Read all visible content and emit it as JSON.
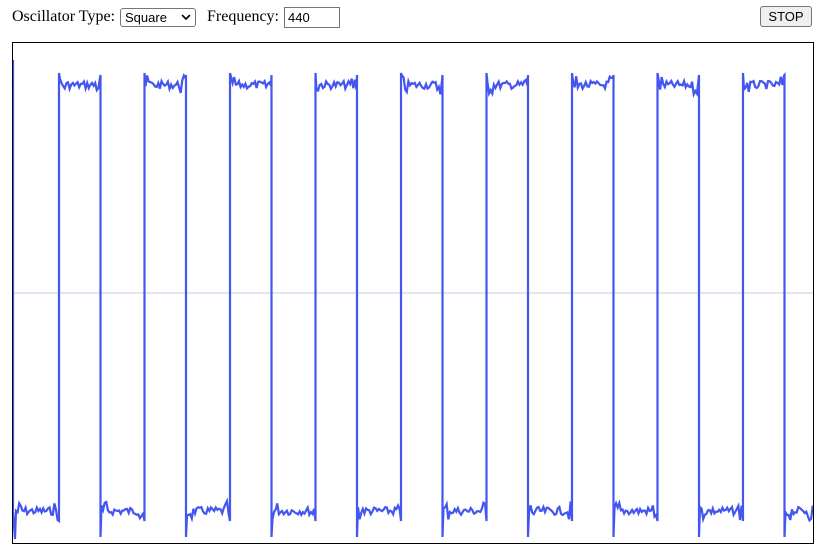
{
  "controls": {
    "oscillator_type_label": "Oscillator Type:",
    "oscillator_type_value": "Square",
    "frequency_label": "Frequency:",
    "frequency_value": "440",
    "stop_label": "STOP"
  },
  "scope": {
    "waveform_color": "#4455f0",
    "center_line_color": "#c8c8ee",
    "background_color": "#ffffff",
    "waveform": "square"
  }
}
